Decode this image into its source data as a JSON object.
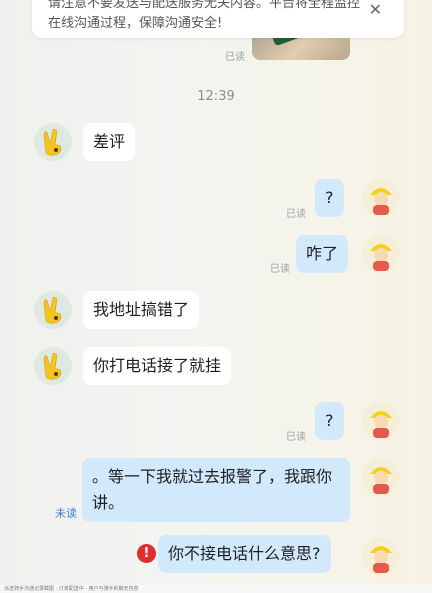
{
  "notice": {
    "text": "请注意不要发送与配送服务无关内容。平台将全程监控在线沟通过程，保障沟通安全!",
    "close_icon": "close-icon"
  },
  "time_divider": "12:39",
  "status_labels": {
    "read": "已读",
    "unread": "未读"
  },
  "messages": [
    {
      "side": "left",
      "text": "差评"
    },
    {
      "side": "right",
      "text": "?",
      "status": "已读"
    },
    {
      "side": "right",
      "text": "咋了",
      "status": "已读"
    },
    {
      "side": "left",
      "text": "我地址搞错了"
    },
    {
      "side": "left",
      "text": "你打电话接了就挂"
    },
    {
      "side": "right",
      "text": "?",
      "status": "已读"
    },
    {
      "side": "right",
      "text": "。等一下我就过去报警了，我跟你讲。",
      "status": "未读"
    },
    {
      "side": "right",
      "text": "你不接电话什么意思?",
      "status": "failed"
    }
  ],
  "footer_text": "派送骑手沟通记录截图 · 订单配送中 · 用户与骑手的聊天内容",
  "colors": {
    "outgoing_bubble": "#d2e8fb",
    "incoming_bubble": "#ffffff",
    "error": "#e02e2e",
    "unread": "#3d7fd8"
  }
}
